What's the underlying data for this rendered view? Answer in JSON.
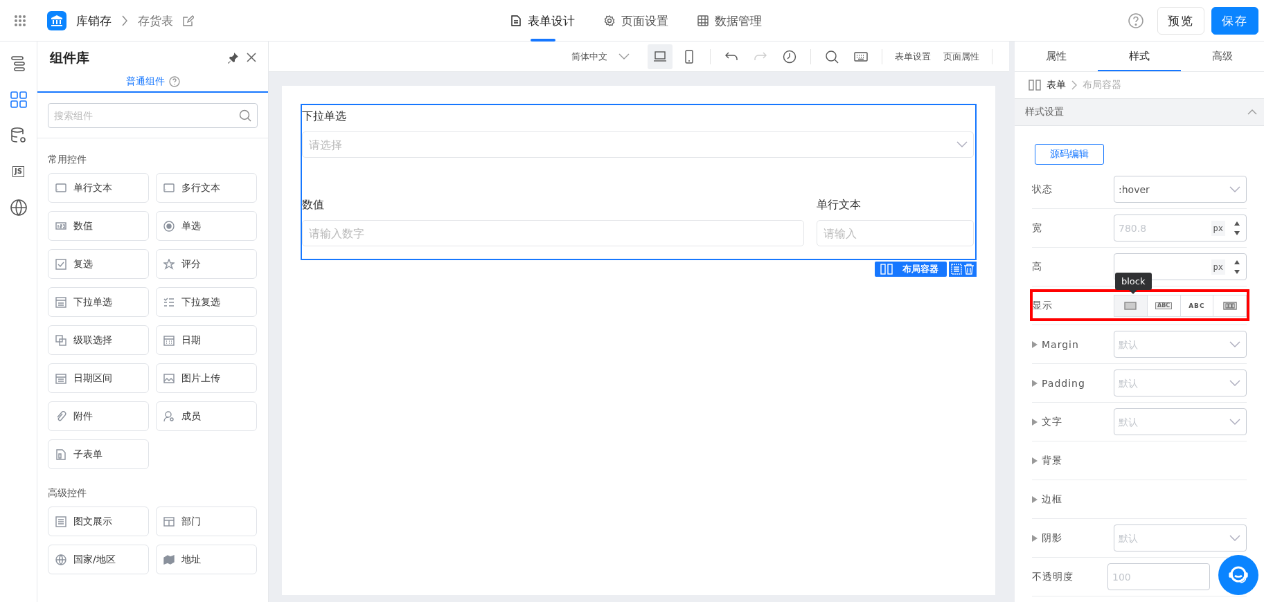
{
  "header": {
    "app": "库销存",
    "page": "存货表",
    "tabs": [
      {
        "label": "表单设计",
        "kind": "doc",
        "selected": true
      },
      {
        "label": "页面设置",
        "kind": "gear",
        "selected": false
      },
      {
        "label": "数据管理",
        "kind": "table",
        "selected": false
      }
    ],
    "buttons": [
      {
        "label": "预览",
        "kind": "default"
      },
      {
        "label": "保存",
        "kind": "primary"
      }
    ]
  },
  "rail": [
    {
      "kind": "outline",
      "selected": false
    },
    {
      "kind": "components",
      "selected": true
    },
    {
      "kind": "data",
      "selected": false
    },
    {
      "kind": "script",
      "text": "JS",
      "selected": false
    },
    {
      "kind": "globe",
      "selected": false
    }
  ],
  "library": {
    "title": "组件库",
    "tabs": [
      {
        "label": "普通组件",
        "selected": true
      }
    ],
    "search": {
      "placeholder": "搜索组件"
    },
    "groups": [
      {
        "title": "常用控件",
        "items": [
          {
            "label": "单行文本",
            "kind": "input"
          },
          {
            "label": "多行文本",
            "kind": "input"
          },
          {
            "label": "数值",
            "kind": "number"
          },
          {
            "label": "单选",
            "kind": "radio"
          },
          {
            "label": "复选",
            "kind": "check"
          },
          {
            "label": "评分",
            "kind": "star"
          },
          {
            "label": "下拉单选",
            "kind": "dropdown"
          },
          {
            "label": "下拉复选",
            "kind": "list"
          },
          {
            "label": "级联选择",
            "kind": "cascade"
          },
          {
            "label": "日期",
            "kind": "calendar"
          },
          {
            "label": "日期区间",
            "kind": "calendar2"
          },
          {
            "label": "图片上传",
            "kind": "image"
          },
          {
            "label": "附件",
            "kind": "clip"
          },
          {
            "label": "成员",
            "kind": "user"
          },
          {
            "label": "子表单",
            "kind": "subform"
          }
        ]
      },
      {
        "title": "高级控件",
        "items": [
          {
            "label": "图文展示",
            "kind": "text"
          },
          {
            "label": "部门",
            "kind": "dept"
          },
          {
            "label": "国家/地区",
            "kind": "globe"
          },
          {
            "label": "地址",
            "kind": "map"
          }
        ]
      }
    ]
  },
  "toolbar": {
    "language": "简体中文",
    "devices": [
      {
        "kind": "desktop",
        "selected": true
      },
      {
        "kind": "mobile",
        "selected": false
      }
    ],
    "tools": [
      {
        "kind": "undo",
        "disabled": false
      },
      {
        "kind": "redo",
        "disabled": true
      },
      {
        "kind": "history",
        "disabled": false
      },
      {
        "kind": "search",
        "disabled": false
      },
      {
        "kind": "keyboard",
        "disabled": false
      }
    ],
    "links": [
      "表单设置",
      "页面属性"
    ]
  },
  "canvas": {
    "rows": [
      [
        {
          "label": "下拉单选",
          "kind": "select",
          "placeholder": "请选择"
        }
      ],
      [
        {
          "label": "数值",
          "kind": "input",
          "placeholder": "请输入数字"
        },
        {
          "label": "单行文本",
          "kind": "input",
          "placeholder": "请输入"
        }
      ]
    ],
    "selection_tag": "布局容器"
  },
  "inspector": {
    "tabs": [
      {
        "label": "属性",
        "selected": false
      },
      {
        "label": "样式",
        "selected": true
      },
      {
        "label": "高级",
        "selected": false
      }
    ],
    "breadcrumb": [
      "表单",
      "布局容器"
    ],
    "section": {
      "title": "样式设置",
      "expanded": true
    },
    "source_button": "源码编辑",
    "rows": [
      {
        "kind": "select",
        "label": "状态",
        "value": ":hover"
      },
      {
        "kind": "number",
        "label": "宽",
        "placeholder": "780.8",
        "unit": "px"
      },
      {
        "kind": "number",
        "label": "高",
        "unit": "px"
      },
      {
        "kind": "segmented",
        "label": "显示",
        "highlighted": true,
        "tooltip": "block",
        "options": [
          {
            "kind": "block",
            "selected": true
          },
          {
            "kind": "inline-block",
            "text": "ABC",
            "selected": false
          },
          {
            "kind": "inline",
            "text": "ABC",
            "selected": false
          },
          {
            "kind": "flex",
            "selected": false
          }
        ]
      },
      {
        "kind": "select",
        "label": "Margin",
        "expanded": false,
        "placeholder": "默认"
      },
      {
        "kind": "select",
        "label": "Padding",
        "expanded": false,
        "placeholder": "默认"
      },
      {
        "kind": "select",
        "label": "文字",
        "expanded": false,
        "placeholder": "默认"
      },
      {
        "kind": "group",
        "label": "背景",
        "expanded": false
      },
      {
        "kind": "group",
        "label": "边框",
        "expanded": false
      },
      {
        "kind": "select",
        "label": "阴影",
        "expanded": false,
        "placeholder": "默认"
      },
      {
        "kind": "input",
        "label": "不透明度",
        "placeholder": "100"
      }
    ]
  }
}
